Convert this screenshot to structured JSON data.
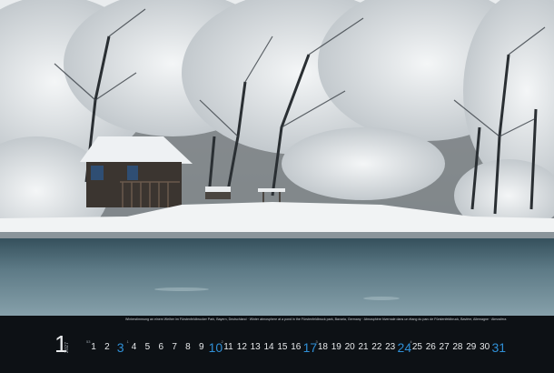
{
  "caption": "Winterstimmung an einem Weiher im Fürstenfeldbrucker Park, Bayern, Deutschland · Winter atmosphere at a pond in the Fürstenfeldbruck park, Bavaria, Germany · Atmosphère hivernale dans un étang du parc de Fürstenfeldbruck, Bavière, Allemagne · Atmosfera invernale in uno stagno nel parco di Fürstenfeldbruck, Baviera, Germania",
  "month": {
    "number": "1",
    "year": "2027"
  },
  "days": [
    {
      "n": "1",
      "wk": "53"
    },
    {
      "n": "2"
    },
    {
      "n": "3",
      "big": true
    },
    {
      "n": "4",
      "wk": "1"
    },
    {
      "n": "5"
    },
    {
      "n": "6"
    },
    {
      "n": "7"
    },
    {
      "n": "8"
    },
    {
      "n": "9"
    },
    {
      "n": "10",
      "big": true
    },
    {
      "n": "11",
      "wk": "2"
    },
    {
      "n": "12"
    },
    {
      "n": "13"
    },
    {
      "n": "14"
    },
    {
      "n": "15"
    },
    {
      "n": "16"
    },
    {
      "n": "17",
      "big": true
    },
    {
      "n": "18",
      "wk": "3"
    },
    {
      "n": "19"
    },
    {
      "n": "20"
    },
    {
      "n": "21"
    },
    {
      "n": "22"
    },
    {
      "n": "23"
    },
    {
      "n": "24",
      "big": true
    },
    {
      "n": "25",
      "wk": "4"
    },
    {
      "n": "26"
    },
    {
      "n": "27"
    },
    {
      "n": "28"
    },
    {
      "n": "29"
    },
    {
      "n": "30"
    },
    {
      "n": "31",
      "big": true
    }
  ],
  "colors": {
    "sunday": "#2f8fd6",
    "background": "#0d1115"
  }
}
